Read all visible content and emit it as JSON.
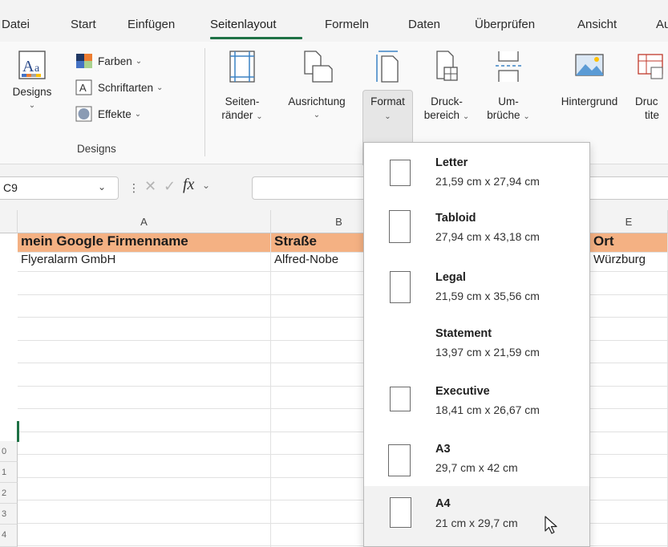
{
  "tabs": [
    {
      "label": "Datei"
    },
    {
      "label": "Start"
    },
    {
      "label": "Einfügen"
    },
    {
      "label": "Seitenlayout",
      "active": true
    },
    {
      "label": "Formeln"
    },
    {
      "label": "Daten"
    },
    {
      "label": "Überprüfen"
    },
    {
      "label": "Ansicht"
    },
    {
      "label": "Au"
    }
  ],
  "ribbon": {
    "designs": {
      "label": "Designs",
      "colors": "Farben",
      "fonts": "Schriftarten",
      "effects": "Effekte",
      "group_label": "Designs"
    },
    "margins": {
      "line1": "Seiten-",
      "line2": "ränder"
    },
    "orientation": {
      "label": "Ausrichtung"
    },
    "format": {
      "label": "Format"
    },
    "print_area": {
      "line1": "Druck-",
      "line2": "bereich"
    },
    "breaks": {
      "line1": "Um-",
      "line2": "brüche"
    },
    "background": {
      "label": "Hintergrund"
    },
    "print_titles": {
      "line1": "Druc",
      "line2": "tite"
    }
  },
  "formula_bar": {
    "cell_ref": "C9",
    "fx": "fx"
  },
  "sheet": {
    "columns": [
      "A",
      "B",
      "E"
    ],
    "header_row": {
      "a": "mein Google Firmenname",
      "b": "Straße",
      "e": "Ort"
    },
    "row1": {
      "a": "Flyeralarm GmbH",
      "b": "Alfred-Nobe",
      "e": "Würzburg"
    },
    "row_numbers": [
      "0",
      "1",
      "2",
      "3",
      "4"
    ]
  },
  "format_menu": [
    {
      "name": "Letter",
      "dims": "21,59 cm x 27,94 cm"
    },
    {
      "name": "Tabloid",
      "dims": "27,94 cm x 43,18 cm"
    },
    {
      "name": "Legal",
      "dims": "21,59 cm x 35,56 cm"
    },
    {
      "name": "Statement",
      "dims": "13,97 cm x 21,59 cm"
    },
    {
      "name": "Executive",
      "dims": "18,41 cm x 26,67 cm"
    },
    {
      "name": "A3",
      "dims": "29,7 cm x 42 cm"
    },
    {
      "name": "A4",
      "dims": "21 cm x 29,7 cm",
      "hovered": true
    }
  ],
  "colors": {
    "accent": "#1e7145",
    "header_fill": "#f4b183"
  }
}
